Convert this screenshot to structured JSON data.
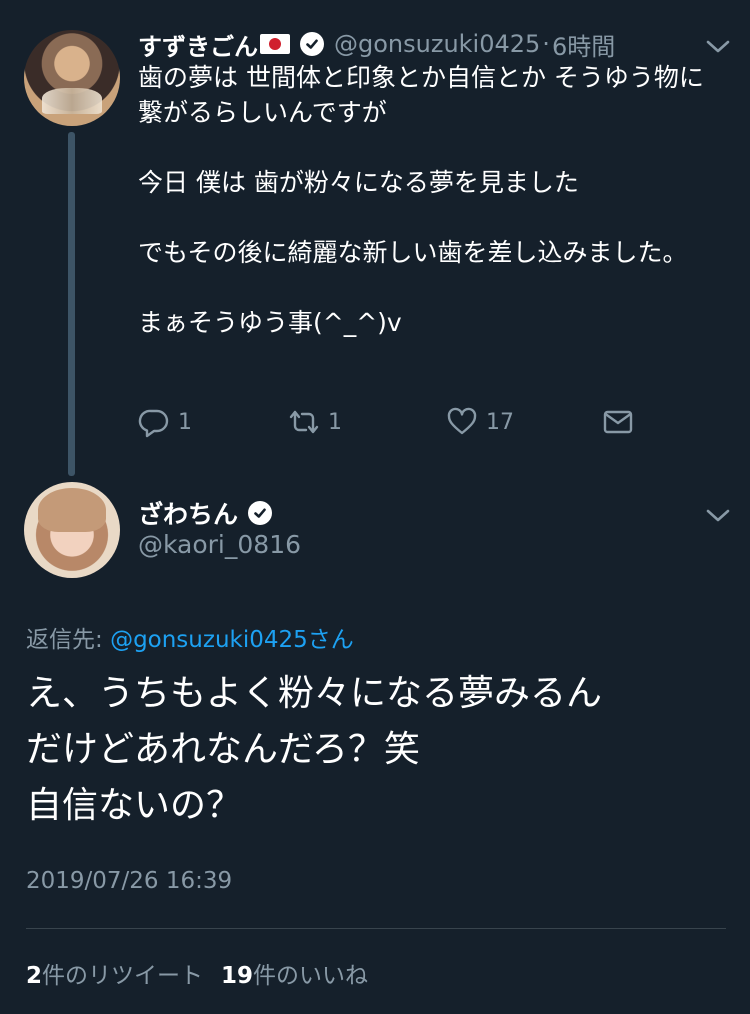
{
  "parent_tweet": {
    "display_name": "すずきごん",
    "handle": "@gonsuzuki0425",
    "separator": "·",
    "time_ago": "6時間",
    "text": "歯の夢は 世間体と印象とか自信とか そうゆう物に繋がるらしいんですが\n\n今日 僕は 歯が粉々になる夢を見ました\n\nでもその後に綺麗な新しい歯を差し込みました。\n\nまぁそうゆう事(^_^)v",
    "reply_count": "1",
    "retweet_count": "1",
    "like_count": "17"
  },
  "reply_tweet": {
    "display_name": "ざわちん",
    "handle": "@kaori_0816",
    "reply_to_label": "返信先: ",
    "reply_to_mention": "@gonsuzuki0425さん",
    "text": "え、うちもよく粉々になる夢みるん\nだけどあれなんだろ？笑\n 自信ないの？",
    "timestamp": "2019/07/26 16:39",
    "retweets_num": "2",
    "retweets_label": "件のリツイート",
    "likes_num": "19",
    "likes_label": "件のいいね"
  },
  "icons": {
    "verified": "verified-badge-icon",
    "chevron": "chevron-down-icon",
    "reply": "reply-icon",
    "retweet": "retweet-icon",
    "like": "heart-icon",
    "dm": "envelope-icon",
    "flag": "japan-flag-icon"
  },
  "colors": {
    "background": "#15202b",
    "secondary_text": "#8899a6",
    "link": "#1da1f2",
    "thread_line": "#3d5466"
  }
}
